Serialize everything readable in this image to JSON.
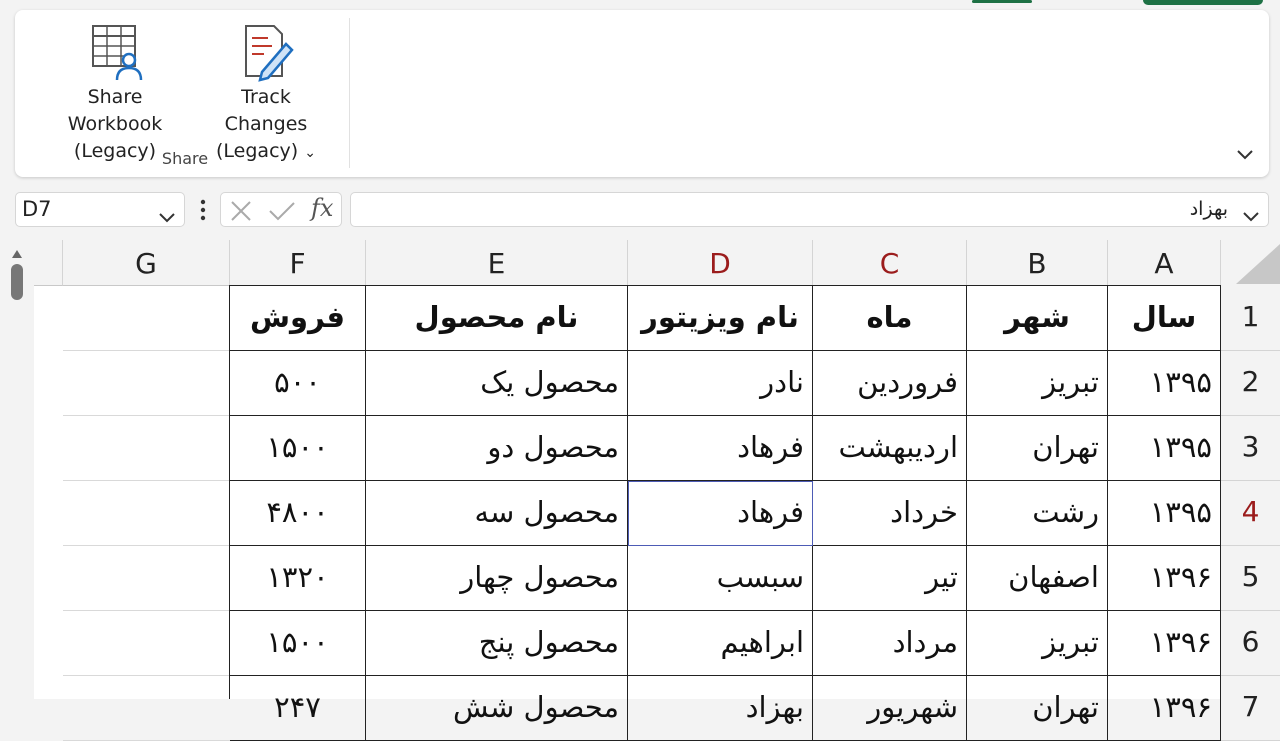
{
  "ribbon": {
    "share_workbook": {
      "line1": "Share Workbook",
      "line2": "(Legacy)"
    },
    "track_changes": {
      "line1": "Track Changes",
      "line2": "(Legacy)"
    },
    "group_label": "Share"
  },
  "formula_bar": {
    "name_box": "D7",
    "fx": "fx",
    "content": "بهزاد"
  },
  "columns": [
    "G",
    "F",
    "E",
    "D",
    "C",
    "B",
    "A"
  ],
  "rows": [
    "1",
    "2",
    "3",
    "4",
    "5",
    "6",
    "7"
  ],
  "table": {
    "headers": {
      "A": "سال",
      "B": "شهر",
      "C": "ماه",
      "D": "نام ویزیتور",
      "E": "نام محصول",
      "F": "فروش"
    },
    "data": [
      {
        "A": "۱۳۹۵",
        "B": "تبریز",
        "C": "فروردین",
        "D": "نادر",
        "E": "محصول یک",
        "F": "۵۰۰"
      },
      {
        "A": "۱۳۹۵",
        "B": "تهران",
        "C": "اردیبهشت",
        "D": "فرهاد",
        "E": "محصول دو",
        "F": "۱۵۰۰"
      },
      {
        "A": "۱۳۹۵",
        "B": "رشت",
        "C": "خرداد",
        "D": "فرهاد",
        "E": "محصول سه",
        "F": "۴۸۰۰"
      },
      {
        "A": "۱۳۹۶",
        "B": "اصفهان",
        "C": "تیر",
        "D": "سبسب",
        "E": "محصول چهار",
        "F": "۱۳۲۰"
      },
      {
        "A": "۱۳۹۶",
        "B": "تبریز",
        "C": "مرداد",
        "D": "ابراهیم",
        "E": "محصول پنج",
        "F": "۱۵۰۰"
      },
      {
        "A": "۱۳۹۶",
        "B": "تهران",
        "C": "شهریور",
        "D": "بهزاد",
        "E": "محصول شش",
        "F": "۲۴۷"
      }
    ]
  }
}
